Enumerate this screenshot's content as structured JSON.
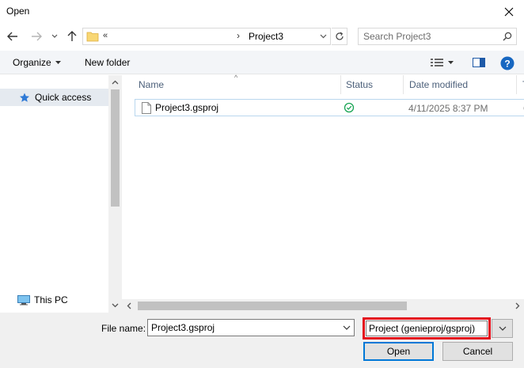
{
  "window": {
    "title": "Open"
  },
  "address": {
    "overflow": "«",
    "separator": "›",
    "crumb": "Project3"
  },
  "search": {
    "placeholder": "Search Project3",
    "value": ""
  },
  "toolbar": {
    "organize_label": "Organize",
    "new_folder_label": "New folder"
  },
  "nav": {
    "quick_access": "Quick access",
    "this_pc": "This PC"
  },
  "columns": {
    "name": "Name",
    "status": "Status",
    "date_modified": "Date modified",
    "more": "T"
  },
  "files": [
    {
      "name": "Project3.gsproj",
      "status": "synced",
      "date_modified": "4/11/2025 8:37 PM",
      "extra": "G"
    }
  ],
  "footer": {
    "file_name_label": "File name:",
    "file_name_value": "Project3.gsproj",
    "file_type_value": "Project (genieproj/gsproj)",
    "open_label": "Open",
    "cancel_label": "Cancel"
  },
  "colors": {
    "highlight_border": "#e30d1b",
    "accent": "#0078d7",
    "selection": "#e5eaf0",
    "status_ok": "#18a454"
  },
  "icons": {
    "close": "close-icon",
    "back": "arrow-left-icon",
    "forward": "arrow-right-icon",
    "recent": "chevron-down-icon",
    "up": "arrow-up-icon",
    "folder": "folder-icon",
    "refresh": "refresh-icon",
    "search": "search-icon",
    "view": "details-view-icon",
    "preview": "preview-pane-icon",
    "help": "help-icon",
    "quick_access": "star-pin-icon",
    "this_pc": "monitor-icon",
    "file": "document-icon",
    "status": "check-circle-icon"
  }
}
